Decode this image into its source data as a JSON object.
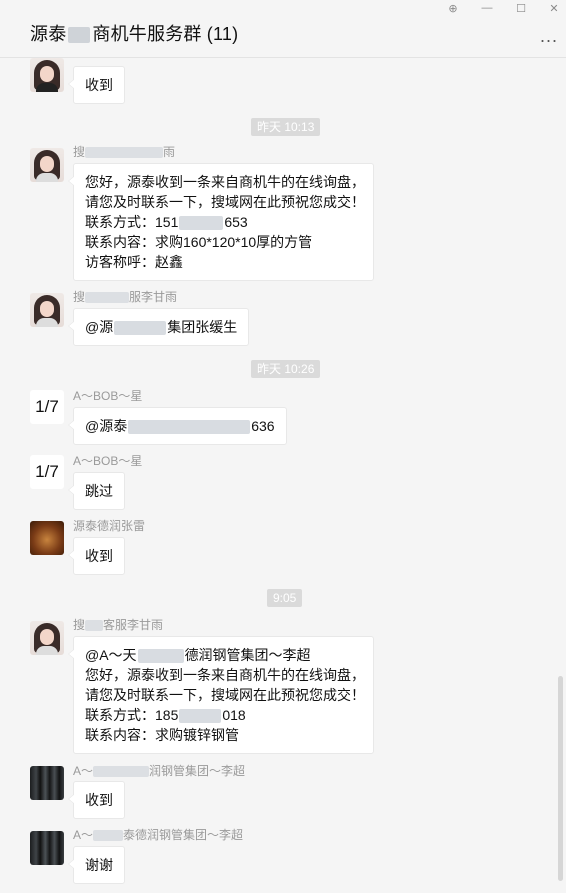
{
  "window": {
    "title_prefix": "源泰",
    "title_suffix": "商机牛服务群 (11)",
    "controls": {
      "pin": "⊕",
      "minimize": "—",
      "maximize": "☐",
      "close": "✕"
    },
    "more": "..."
  },
  "messages": [
    {
      "avatar": "girl-dark",
      "sender": "",
      "lines": [
        "收到"
      ]
    },
    {
      "time": "昨天 10:13"
    },
    {
      "avatar": "girl",
      "sender_prefix": "搜",
      "sender_suffix": "雨",
      "lines": [
        "您好，源泰收到一条来自商机牛的在线询盘，",
        "请您及时联系一下，搜域网在此预祝您成交！",
        "联系方式：151",
        "联系内容：求购160*120*10厚的方管",
        "访客称呼：赵鑫"
      ],
      "phone_end": "653"
    },
    {
      "avatar": "girl",
      "sender_prefix": "搜",
      "sender_suffix": "服李甘雨",
      "lines": [
        "@源",
        "集团张缓生"
      ]
    },
    {
      "time": "昨天 10:26"
    },
    {
      "avatar": "text",
      "avatar_text": "1/7",
      "sender": "A～BOB～星",
      "lines": [
        "@源泰",
        "636"
      ]
    },
    {
      "avatar": "text",
      "avatar_text": "1/7",
      "sender": "A～BOB～星",
      "lines": [
        "跳过"
      ]
    },
    {
      "avatar": "food",
      "sender": "源泰德润张雷",
      "lines": [
        "收到"
      ]
    },
    {
      "time": "9:05"
    },
    {
      "avatar": "girl",
      "sender_prefix": "搜",
      "sender_suffix": "客服李甘雨",
      "lines": [
        "@A～天",
        "德润钢管集团～李超",
        "您好，源泰收到一条来自商机牛的在线询盘，",
        "请您及时联系一下，搜域网在此预祝您成交！",
        "联系方式：185",
        "018",
        "联系内容：求购镀锌钢管"
      ]
    },
    {
      "avatar": "steel",
      "sender_prefix": "A～",
      "sender_suffix": "润钢管集团～李超",
      "lines": [
        "收到"
      ]
    },
    {
      "avatar": "steel",
      "sender_prefix": "A～",
      "sender_suffix": "泰德润钢管集团～李超",
      "lines": [
        "谢谢"
      ]
    }
  ]
}
